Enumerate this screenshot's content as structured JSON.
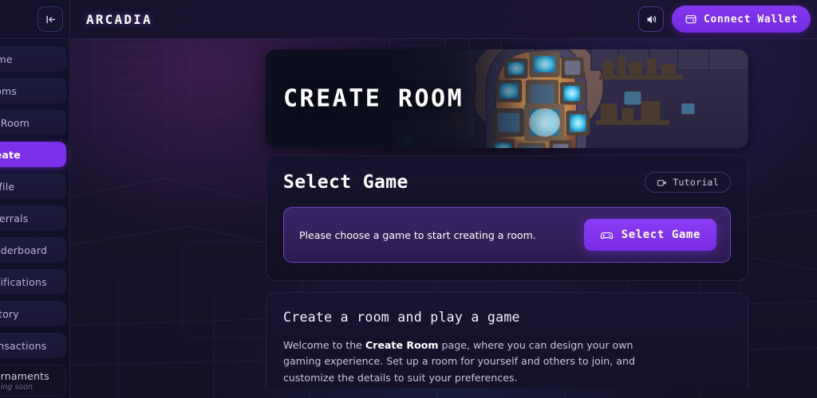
{
  "sidebar": {
    "collapse_icon": "collapse-sidebar-icon",
    "items": [
      {
        "label": "Home",
        "active": false
      },
      {
        "label": "Rooms",
        "active": false
      },
      {
        "label": "My Room",
        "active": false
      },
      {
        "label": "Create",
        "active": true
      },
      {
        "label": "Profile",
        "active": false
      },
      {
        "label": "Referrals",
        "active": false
      },
      {
        "label": "Leaderboard",
        "active": false
      },
      {
        "label": "Notifications",
        "active": false
      },
      {
        "label": "History",
        "active": false
      },
      {
        "label": "Transactions",
        "active": false
      }
    ],
    "soon_item": {
      "label": "Tournaments",
      "sub": "Coming soon"
    }
  },
  "header": {
    "logo": "ARCADIA",
    "sound_icon": "speaker-volume-icon",
    "wallet": {
      "icon": "wallet-icon",
      "label": "Connect Wallet"
    }
  },
  "hero": {
    "title": "CREATE ROOM",
    "art": "retro-tv-cave-pixel-art"
  },
  "select_game": {
    "title": "Select Game",
    "tutorial": {
      "icon": "video-tutorial-icon",
      "label": "Tutorial"
    },
    "prompt": "Please choose a game to start creating a room.",
    "button": {
      "icon": "gamepad-icon",
      "label": "Select Game"
    }
  },
  "info": {
    "title": "Create a room and play a game",
    "body_lead": "Welcome to the ",
    "body_bold": "Create Room",
    "body_rest": " page, where you can design your own gaming experience. Set up a room for yourself and others to join, and customize the details to suit your preferences."
  },
  "colors": {
    "accent": "#7c2fe8",
    "accent_light": "#8a3df3",
    "panel": "#171430",
    "border": "#262046",
    "bg": "#17122a"
  }
}
